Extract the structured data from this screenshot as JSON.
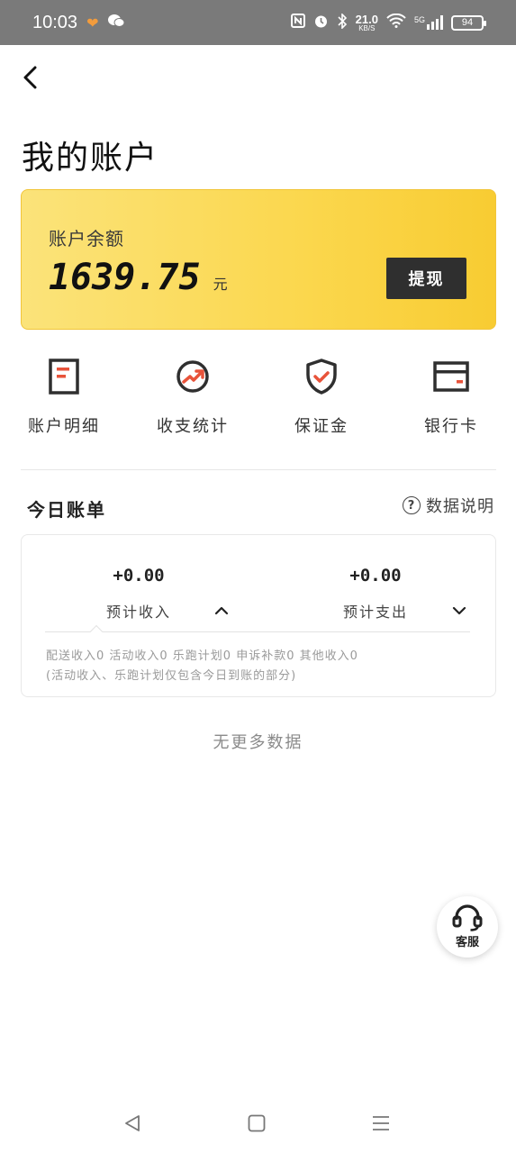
{
  "status_bar": {
    "time": "10:03",
    "net_speed": "21.0",
    "net_unit": "KB/S",
    "network": "5G",
    "battery": "94"
  },
  "header": {
    "title": "我的账户"
  },
  "balance": {
    "label": "账户余额",
    "amount": "1639.75",
    "unit": "元",
    "withdraw_label": "提现"
  },
  "shortcuts": [
    {
      "label": "账户明细",
      "icon": "document-icon"
    },
    {
      "label": "收支统计",
      "icon": "trend-chart-icon"
    },
    {
      "label": "保证金",
      "icon": "shield-check-icon"
    },
    {
      "label": "银行卡",
      "icon": "bank-card-icon"
    }
  ],
  "today_bill": {
    "title": "今日账单",
    "help_label": "数据说明",
    "income": {
      "value": "+0.00",
      "label": "预计收入"
    },
    "expense": {
      "value": "+0.00",
      "label": "预计支出"
    },
    "detail_line1": "配送收入0 活动收入0 乐跑计划0 申诉补款0 其他收入0",
    "detail_line2": "(活动收入、乐跑计划仅包含今日到账的部分)"
  },
  "no_more": "无更多数据",
  "service": {
    "label": "客服"
  },
  "colors": {
    "card_gradient_start": "#fbe37a",
    "card_gradient_end": "#f8cc32",
    "accent_red": "#e8533a",
    "button_dark": "#2f2f2f"
  }
}
